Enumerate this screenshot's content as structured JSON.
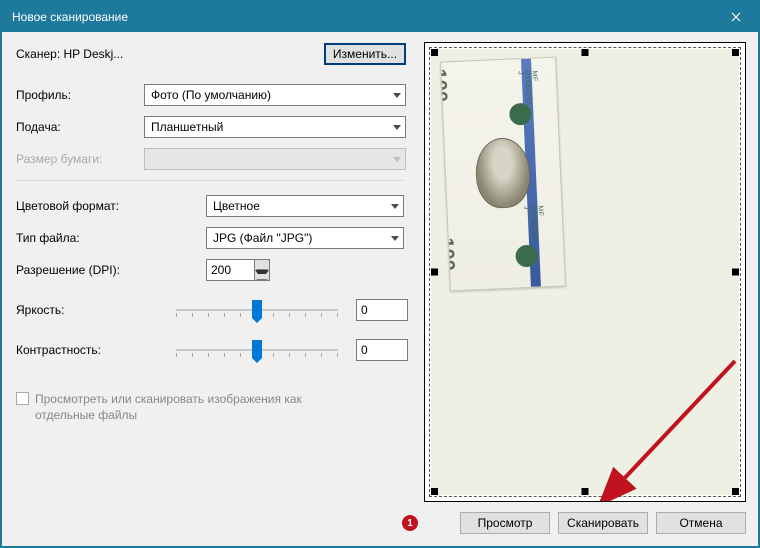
{
  "title": "Новое сканирование",
  "scanner": {
    "label_prefix": "Сканер:",
    "name": "HP Deskj...",
    "change_button": "Изменить..."
  },
  "profile": {
    "label": "Профиль:",
    "value": "Фото (По умолчанию)"
  },
  "source": {
    "label": "Подача:",
    "value": "Планшетный"
  },
  "paper_size": {
    "label": "Размер бумаги:",
    "value": ""
  },
  "color_format": {
    "label": "Цветовой формат:",
    "value": "Цветное"
  },
  "file_type": {
    "label": "Тип файла:",
    "value": "JPG (Файл \"JPG\")"
  },
  "resolution": {
    "label": "Разрешение (DPI):",
    "value": "200"
  },
  "brightness": {
    "label": "Яркость:",
    "value": "0"
  },
  "contrast": {
    "label": "Контрастность:",
    "value": "0"
  },
  "separate_checkbox": {
    "label": "Просмотреть или сканировать изображения как отдельные файлы",
    "checked": false
  },
  "buttons": {
    "preview": "Просмотр",
    "scan": "Сканировать",
    "cancel": "Отмена"
  },
  "annotation": {
    "badge": "1"
  },
  "bill": {
    "denom": "100",
    "serial1": "MF 01080055 J",
    "serial2": "MF 01080055 J"
  }
}
